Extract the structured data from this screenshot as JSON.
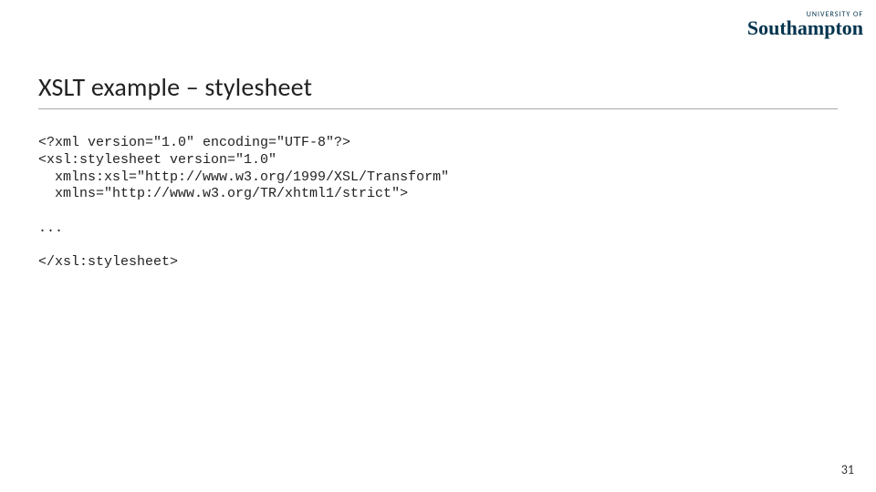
{
  "logo": {
    "line1": "UNIVERSITY OF",
    "line2_bold": "Southampton",
    "line2_rest": ""
  },
  "title": "XSLT example – stylesheet",
  "code": {
    "line1": "<?xml version=\"1.0\" encoding=\"UTF-8\"?>",
    "line2": "<xsl:stylesheet version=\"1.0\"",
    "line3": "  xmlns:xsl=\"http://www.w3.org/1999/XSL/Transform\"",
    "line4": "  xmlns=\"http://www.w3.org/TR/xhtml1/strict\">",
    "line5": "",
    "line6": "...",
    "line7": "",
    "line8": "</xsl:stylesheet>"
  },
  "page_number": "31"
}
